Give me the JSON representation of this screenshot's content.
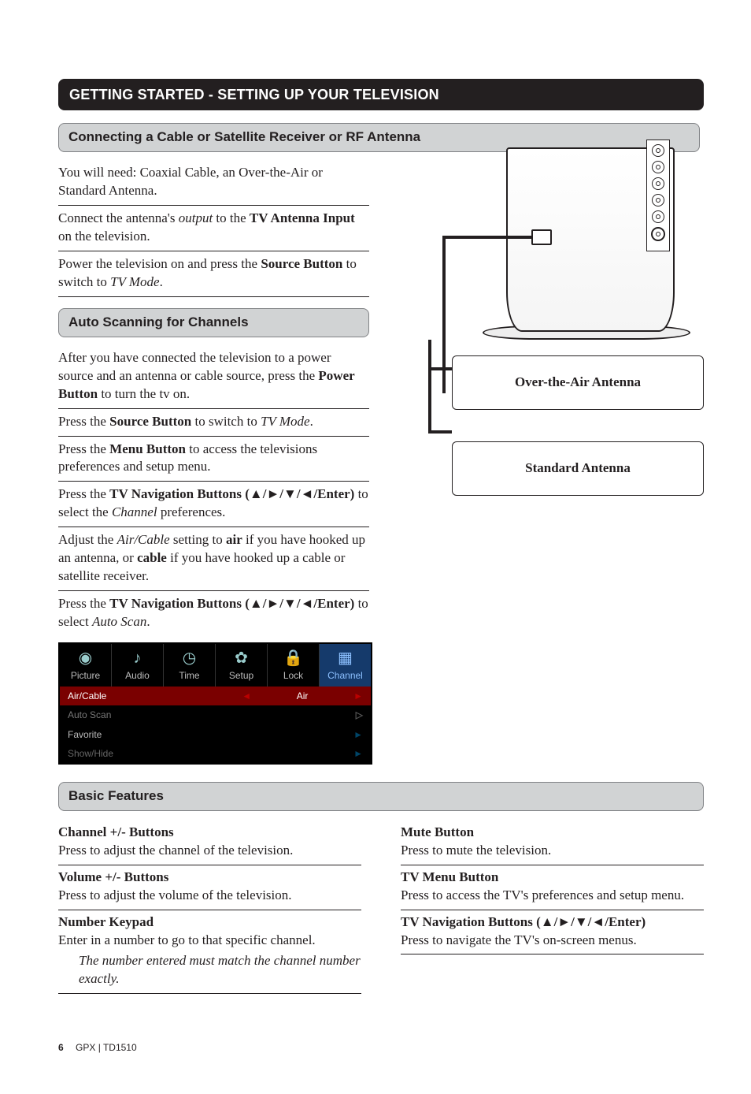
{
  "section_title": "GETTING STARTED - SETTING UP YOUR TELEVISION",
  "connect": {
    "heading": "Connecting a Cable or Satellite Receiver or RF Antenna",
    "p1_a": "You will need: Coaxial Cable, an Over-the-Air or Standard Antenna.",
    "p2_a": "Connect the antenna's ",
    "p2_i": "output",
    "p2_b": " to the ",
    "p2_bold": "TV Antenna Input",
    "p2_c": " on the television.",
    "p3_a": "Power the television on and press the ",
    "p3_bold": "Source Button",
    "p3_b": " to switch to ",
    "p3_i": "TV Mode",
    "p3_c": "."
  },
  "diagram": {
    "box1": "Over-the-Air Antenna",
    "box2": "Standard Antenna"
  },
  "autoscan": {
    "heading": "Auto Scanning for Channels",
    "s1_a": "After you have connected the television to a power source and an antenna or cable source, press the ",
    "s1_bold": "Power Button",
    "s1_b": " to turn the tv on.",
    "s2_a": "Press the ",
    "s2_bold": "Source Button",
    "s2_b": " to switch to ",
    "s2_i": "TV Mode",
    "s2_c": ".",
    "s3_a": "Press the ",
    "s3_bold": "Menu Button",
    "s3_b": " to access the televisions preferences and setup menu.",
    "s4_a": "Press the ",
    "s4_bold": "TV Navigation Buttons (▲/►/▼/◄/Enter)",
    "s4_b": " to select the ",
    "s4_i": "Channel",
    "s4_c": " preferences.",
    "s5_a": "Adjust the ",
    "s5_i": "Air/Cable",
    "s5_b": " setting to ",
    "s5_bold1": "air",
    "s5_c": " if you have hooked up an antenna, or ",
    "s5_bold2": "cable",
    "s5_d": " if you have hooked up a cable or satellite receiver.",
    "s6_a": "Press the ",
    "s6_bold": "TV Navigation Buttons (▲/►/▼/◄/Enter)",
    "s6_b": " to select ",
    "s6_i": "Auto Scan",
    "s6_c": "."
  },
  "menu": {
    "tabs": [
      "Picture",
      "Audio",
      "Time",
      "Setup",
      "Lock",
      "Channel"
    ],
    "r1k": "Air/Cable",
    "r1v": "Air",
    "r2k": "Auto Scan",
    "r3k": "Favorite",
    "r4k": "Show/Hide"
  },
  "basic": {
    "heading": "Basic Features",
    "left": {
      "f1t": "Channel +/- Buttons",
      "f1d": "Press to adjust the channel of the television.",
      "f2t": "Volume +/- Buttons",
      "f2d": "Press to adjust the volume of the television.",
      "f3t": "Number Keypad",
      "f3d": "Enter in a number to go to that specific channel.",
      "f3n": "The number entered must match the channel number exactly."
    },
    "right": {
      "f1t": "Mute Button",
      "f1d": "Press to mute the television.",
      "f2t": "TV Menu Button",
      "f2d": "Press to access the TV's preferences and setup menu.",
      "f3t": "TV Navigation Buttons (▲/►/▼/◄/Enter)",
      "f3d": "Press to navigate the TV's on-screen menus."
    }
  },
  "footer": {
    "page": "6",
    "model": "GPX  |  TD1510"
  }
}
